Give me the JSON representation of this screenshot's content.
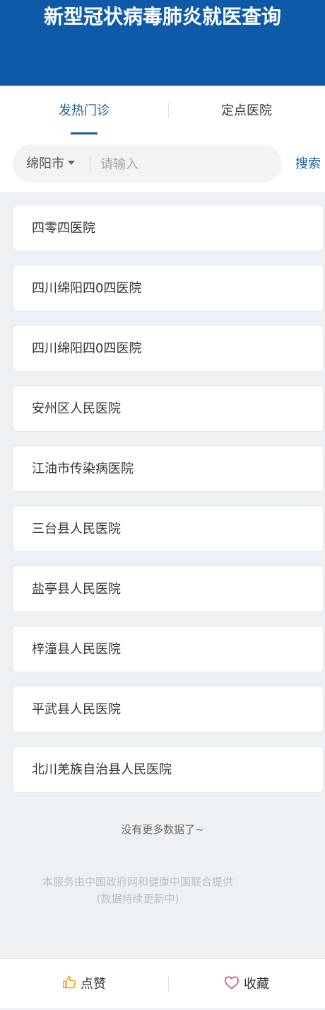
{
  "header": {
    "title": "新型冠状病毒肺炎就医查询"
  },
  "tabs": [
    {
      "label": "发热门诊",
      "active": true
    },
    {
      "label": "定点医院",
      "active": false
    }
  ],
  "search": {
    "city": "绵阳市",
    "placeholder": "请输入",
    "value": "",
    "button_label": "搜索"
  },
  "hospitals": [
    "四零四医院",
    "四川绵阳四0四医院",
    "四川绵阳四0四医院",
    "安州区人民医院",
    "江油市传染病医院",
    "三台县人民医院",
    "盐亭县人民医院",
    "梓潼县人民医院",
    "平武县人民医院",
    "北川羌族自治县人民医院"
  ],
  "footer": {
    "no_more": "没有更多数据了~",
    "credit_line1": "本服务由中国政府网和健康中国联合提供",
    "credit_line2": "(数据持续更新中)"
  },
  "bottom_bar": {
    "like_label": "点赞",
    "favorite_label": "收藏",
    "like_icon": "thumbs-up-icon",
    "favorite_icon": "heart-icon",
    "like_icon_color": "#f0a020",
    "favorite_icon_color": "#e0506a"
  },
  "colors": {
    "header_bg": "#0f5aa8",
    "accent": "#1f5f9e"
  }
}
